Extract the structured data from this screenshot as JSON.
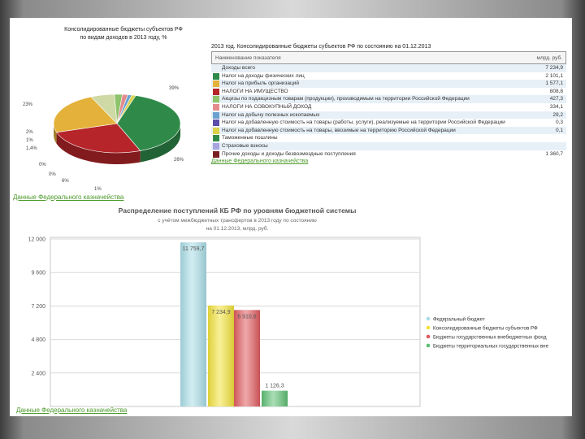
{
  "pie": {
    "title_line1": "Консолидированные бюджеты субъектов РФ",
    "title_line2": "по видам доходов в 2013 году, %",
    "labels": [
      "39%",
      "23%",
      "26%",
      "2%",
      "1%",
      "1,4%",
      "0%",
      "0%",
      "6%",
      "1%"
    ],
    "slices": [
      {
        "value": 39,
        "color": "#2f8a4a"
      },
      {
        "value": 26,
        "color": "#b5252a"
      },
      {
        "value": 23,
        "color": "#e4b23a"
      },
      {
        "value": 6,
        "color": "#cfd9a5"
      },
      {
        "value": 2,
        "color": "#8ec26b"
      },
      {
        "value": 1.4,
        "color": "#e38b8d"
      },
      {
        "value": 1,
        "color": "#6aa2cf"
      },
      {
        "value": 1,
        "color": "#d9d24a"
      }
    ],
    "source_link": "Данные Федерального казначейства"
  },
  "table": {
    "title": "2013 год. Консолидированные бюджеты субъектов РФ по состоянию на 01.12.2013",
    "header_left": "Наименование показателя",
    "header_right": "млрд. руб.",
    "rows": [
      {
        "label": "Доходы всего",
        "value": "7 234,9",
        "color": ""
      },
      {
        "label": "Налог на доходы физических лиц",
        "value": "2 101,1",
        "color": "#2f8a4a"
      },
      {
        "label": "Налог на прибыль организаций",
        "value": "1 577,1",
        "color": "#e4b23a"
      },
      {
        "label": "НАЛОГИ НА ИМУЩЕСТВО",
        "value": "808,8",
        "color": "#b5252a"
      },
      {
        "label": "Акцизы по подакцизным товарам (продукции), производимым на территории Российской Федерации",
        "value": "427,3",
        "color": "#8ec26b"
      },
      {
        "label": "НАЛОГИ НА СОВОКУПНЫЙ ДОХОД",
        "value": "334,1",
        "color": "#e38b8d"
      },
      {
        "label": "Налог на добычу полезных ископаемых",
        "value": "29,2",
        "color": "#6aa2cf"
      },
      {
        "label": "Налог на добавленную стоимость на товары (работы, услуги), реализуемые на территории Российской Федерации",
        "value": "0,3",
        "color": "#5b4ea8"
      },
      {
        "label": "Налог на добавленную стоимость на товары, ввозимые на территорию Российской Федерации",
        "value": "0,1",
        "color": "#d9d24a"
      },
      {
        "label": "Таможенные пошлины",
        "value": "",
        "color": "#2f8a4a"
      },
      {
        "label": "Страховые взносы",
        "value": "",
        "color": "#a7a4e0"
      },
      {
        "label": "Прочие доходы и доходы безвозмездные поступления",
        "value": "1 360,7",
        "color": "#7a1f22"
      }
    ],
    "source_link": "Данные Федерального казначейства"
  },
  "chart_data": {
    "type": "bar",
    "title": "Распределение поступлений КБ РФ по уровням бюджетной системы",
    "subtitle_line1": "с учётом межбюджетных трансфертов в 2013 году по состоянию",
    "subtitle_line2": "на 01.12.2013, млрд. руб.",
    "categories": [
      "Федеральный бюджет",
      "Консолидированные бюджеты субъектов РФ",
      "Бюджеты государственных внебюджетных фонд",
      "Бюджеты территориальных государственных вне"
    ],
    "values": [
      11759.7,
      7234.9,
      6910.6,
      1126.3
    ],
    "value_labels": [
      "11 759,7",
      "7 234,9",
      "6 910,6",
      "1 126,3"
    ],
    "colors": [
      "#a9dde6",
      "#f2e23a",
      "#e05a5e",
      "#5cbf72"
    ],
    "yticks": [
      2400,
      4800,
      7200,
      9600,
      12000
    ],
    "ytick_labels": [
      "2 400",
      "4 800",
      "7 200",
      "9 600",
      "12 000"
    ],
    "ylim": [
      0,
      12000
    ],
    "grid": true,
    "legend_position": "right",
    "source_link": "Данные Федерального казначейства"
  }
}
